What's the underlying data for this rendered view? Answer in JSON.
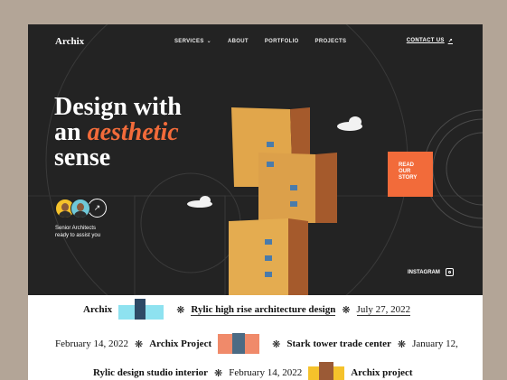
{
  "brand": {
    "logo": "Archix"
  },
  "nav": {
    "items": [
      "SERVICES",
      "ABOUT",
      "PORTFOLIO",
      "PROJECTS"
    ],
    "contact": "CONTACT US",
    "contact_arrow": "↗",
    "services_chevron": "⌄"
  },
  "hero": {
    "headline_line1": "Design with",
    "headline_an": "an",
    "headline_accent": "aesthetic",
    "headline_line3": "sense",
    "senior_line1": "Senior Architects",
    "senior_line2": "ready to assist you",
    "arrow": "↗",
    "read_line1": "READ",
    "read_line2": "OUR",
    "read_line3": "STORY",
    "instagram": "INSTAGRAM"
  },
  "marquee": {
    "row1": [
      "Archix",
      "Rylic high rise architecture design",
      "July 27, 2022"
    ],
    "row2": [
      "February 14, 2022",
      "Archix Project",
      "Stark tower trade center",
      "January 12,"
    ],
    "row3": [
      "Rylic design studio interior",
      "February 14, 2022",
      "Archix project"
    ],
    "separator": "❋"
  },
  "colors": {
    "accent": "#f26b3a",
    "hero_bg": "#232323",
    "page_bg": "#b3a597"
  }
}
